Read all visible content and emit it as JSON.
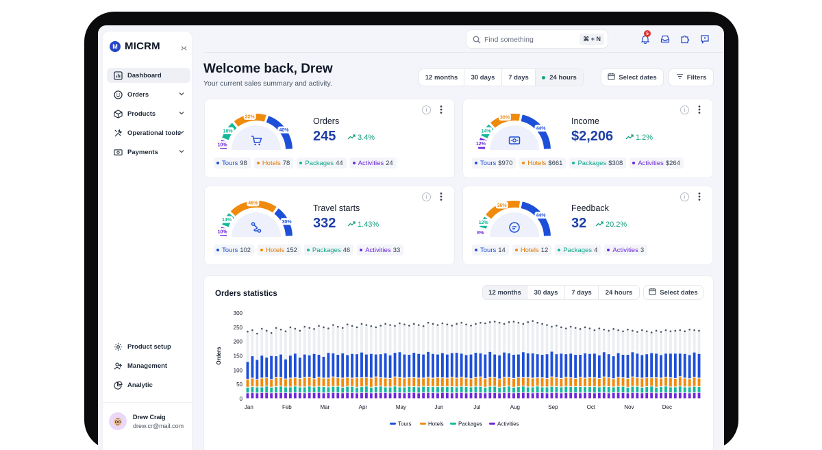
{
  "brand": {
    "name": "MICRM",
    "logo_letter": "M"
  },
  "sidebar": {
    "items": [
      {
        "label": "Dashboard",
        "icon": "chart-bar-icon"
      },
      {
        "label": "Orders",
        "icon": "smile-icon"
      },
      {
        "label": "Products",
        "icon": "box-icon"
      },
      {
        "label": "Operational tools",
        "icon": "tools-icon"
      },
      {
        "label": "Payments",
        "icon": "money-icon"
      }
    ],
    "bottom_items": [
      {
        "label": "Product setup",
        "icon": "gear-icon"
      },
      {
        "label": "Management",
        "icon": "users-icon"
      },
      {
        "label": "Analytic",
        "icon": "pie-chart-icon"
      }
    ],
    "user": {
      "name": "Drew Craig",
      "email": "drew.cr@mail.com"
    }
  },
  "topbar": {
    "search_placeholder": "Find something",
    "shortcut": "⌘ + N",
    "notification_count": "5"
  },
  "header": {
    "title": "Welcome back, Drew",
    "subtitle": "Your current sales summary and activity.",
    "ranges": [
      "12 months",
      "30 days",
      "7 days",
      "24 hours"
    ],
    "active_range": "24 hours",
    "select_dates": "Select dates",
    "filters": "Filters"
  },
  "colors": {
    "tours": "#1d4fd8",
    "hotels": "#f08a0c",
    "packages": "#14b89a",
    "activities": "#6d28d9",
    "accent": "#1d3fa8",
    "positive": "#16a07f"
  },
  "cards": [
    {
      "title": "Orders",
      "value": "245",
      "delta": "3.4%",
      "icon": "cart-icon",
      "segments": [
        {
          "pct": "10%",
          "share": 10
        },
        {
          "pct": "18%",
          "share": 18
        },
        {
          "pct": "32%",
          "share": 32
        },
        {
          "pct": "40%",
          "share": 40
        }
      ],
      "legend": [
        {
          "name": "Tours",
          "value": "98"
        },
        {
          "name": "Hotels",
          "value": "78"
        },
        {
          "name": "Packages",
          "value": "44"
        },
        {
          "name": "Activities",
          "value": "24"
        }
      ]
    },
    {
      "title": "Income",
      "value": "$2,206",
      "delta": "1.2%",
      "icon": "money-icon",
      "segments": [
        {
          "pct": "12%",
          "share": 12
        },
        {
          "pct": "14%",
          "share": 14
        },
        {
          "pct": "30%",
          "share": 30
        },
        {
          "pct": "44%",
          "share": 44
        }
      ],
      "legend": [
        {
          "name": "Tours",
          "value": "$970"
        },
        {
          "name": "Hotels",
          "value": "$661"
        },
        {
          "name": "Packages",
          "value": "$308"
        },
        {
          "name": "Activities",
          "value": "$264"
        }
      ]
    },
    {
      "title": "Travel starts",
      "value": "332",
      "delta": "1.43%",
      "icon": "route-icon",
      "segments": [
        {
          "pct": "10%",
          "share": 10
        },
        {
          "pct": "14%",
          "share": 14
        },
        {
          "pct": "46%",
          "share": 46
        },
        {
          "pct": "30%",
          "share": 30
        }
      ],
      "legend": [
        {
          "name": "Tours",
          "value": "102"
        },
        {
          "name": "Hotels",
          "value": "152"
        },
        {
          "name": "Packages",
          "value": "46"
        },
        {
          "name": "Activities",
          "value": "33"
        }
      ]
    },
    {
      "title": "Feedback",
      "value": "32",
      "delta": "20.2%",
      "icon": "chat-icon",
      "segments": [
        {
          "pct": "8%",
          "share": 8
        },
        {
          "pct": "12%",
          "share": 12
        },
        {
          "pct": "36%",
          "share": 36
        },
        {
          "pct": "44%",
          "share": 44
        }
      ],
      "legend": [
        {
          "name": "Tours",
          "value": "14"
        },
        {
          "name": "Hotels",
          "value": "12"
        },
        {
          "name": "Packages",
          "value": "4"
        },
        {
          "name": "Activities",
          "value": "3"
        }
      ]
    }
  ],
  "stats": {
    "title": "Orders statistics",
    "ranges": [
      "12 months",
      "30 days",
      "7 days",
      "24 hours"
    ],
    "active_range": "12 months",
    "select_dates": "Select dates"
  },
  "chart_data": {
    "type": "bar",
    "stacked": true,
    "ylabel": "Orders",
    "ylim": [
      0,
      300
    ],
    "yticks": [
      0,
      50,
      100,
      150,
      200,
      250,
      300
    ],
    "month_labels": [
      "Jan",
      "Feb",
      "Mar",
      "Apr",
      "May",
      "Jun",
      "Jul",
      "Aug",
      "Sep",
      "Oct",
      "Nov",
      "Dec"
    ],
    "bars_per_month": 8,
    "legend": [
      "Tours",
      "Hotels",
      "Packages",
      "Activities"
    ],
    "legend_position": "bottom",
    "series": [
      {
        "name": "Activities",
        "values": [
          20,
          22,
          20,
          21,
          22,
          20,
          21,
          22,
          21,
          20,
          22,
          21,
          20,
          22,
          21,
          22,
          20,
          21,
          22,
          21,
          20,
          22,
          21,
          20,
          21,
          22,
          20,
          21,
          22,
          21,
          20,
          22,
          21,
          20,
          21,
          22,
          20,
          21,
          22,
          21,
          20,
          22,
          21,
          20,
          21,
          22,
          20,
          21,
          22,
          21,
          20,
          22,
          21,
          20,
          21,
          22,
          20,
          21,
          22,
          21,
          20,
          22,
          21,
          20,
          21,
          22,
          20,
          21,
          22,
          21,
          20,
          22,
          21,
          20,
          21,
          22,
          20,
          21,
          22,
          21,
          20,
          22,
          21,
          20,
          21,
          22,
          20,
          21,
          22,
          21,
          20,
          22,
          21,
          20,
          21,
          22
        ]
      },
      {
        "name": "Packages",
        "values": [
          20,
          20,
          21,
          20,
          22,
          20,
          21,
          22,
          20,
          21,
          22,
          20,
          21,
          22,
          20,
          21,
          22,
          20,
          21,
          22,
          20,
          21,
          22,
          20,
          21,
          22,
          20,
          21,
          22,
          20,
          21,
          22,
          20,
          21,
          22,
          20,
          21,
          22,
          20,
          21,
          22,
          20,
          21,
          22,
          20,
          21,
          22,
          20,
          21,
          22,
          20,
          21,
          22,
          20,
          21,
          22,
          20,
          21,
          22,
          20,
          21,
          22,
          20,
          21,
          22,
          20,
          21,
          22,
          20,
          21,
          22,
          20,
          21,
          22,
          20,
          21,
          22,
          20,
          21,
          22,
          20,
          21,
          22,
          20,
          21,
          22,
          20,
          21,
          22,
          20,
          21,
          22,
          20,
          21,
          22,
          20
        ]
      },
      {
        "name": "Hotels",
        "values": [
          28,
          30,
          26,
          31,
          29,
          27,
          32,
          30,
          28,
          31,
          29,
          30,
          33,
          31,
          29,
          32,
          30,
          31,
          33,
          30,
          32,
          31,
          29,
          33,
          31,
          30,
          32,
          34,
          29,
          31,
          30,
          32,
          33,
          31,
          30,
          32,
          31,
          29,
          33,
          30,
          32,
          31,
          30,
          33,
          31,
          32,
          30,
          29,
          31,
          33,
          30,
          32,
          31,
          29,
          33,
          30,
          31,
          32,
          30,
          33,
          31,
          29,
          32,
          30,
          33,
          31,
          30,
          32,
          31,
          29,
          33,
          30,
          32,
          31,
          30,
          33,
          31,
          29,
          32,
          30,
          31,
          33,
          30,
          32,
          31,
          29,
          33,
          30,
          31,
          32,
          30,
          33,
          31,
          29,
          32,
          30
        ]
      },
      {
        "name": "Tours",
        "values": [
          62,
          78,
          70,
          80,
          72,
          84,
          76,
          82,
          70,
          80,
          86,
          74,
          82,
          78,
          88,
          80,
          76,
          90,
          84,
          82,
          88,
          80,
          86,
          84,
          90,
          82,
          86,
          80,
          84,
          88,
          82,
          86,
          90,
          84,
          82,
          88,
          86,
          84,
          90,
          86,
          82,
          88,
          84,
          86,
          90,
          84,
          82,
          86,
          88,
          84,
          86,
          90,
          82,
          84,
          88,
          86,
          84,
          82,
          90,
          86,
          88,
          84,
          82,
          86,
          90,
          84,
          88,
          82,
          86,
          84,
          80,
          88,
          84,
          86,
          82,
          88,
          84,
          80,
          86,
          82,
          84,
          88,
          86,
          82,
          84,
          88,
          86,
          82,
          84,
          86,
          88,
          82,
          86,
          84,
          88,
          86
        ]
      },
      {
        "name": "Total",
        "values": [
          235,
          240,
          228,
          245,
          238,
          230,
          248,
          242,
          236,
          250,
          245,
          238,
          252,
          248,
          244,
          255,
          250,
          246,
          258,
          252,
          248,
          260,
          255,
          250,
          262,
          258,
          254,
          250,
          256,
          262,
          258,
          255,
          264,
          260,
          256,
          262,
          258,
          254,
          266,
          262,
          258,
          264,
          260,
          256,
          262,
          266,
          260,
          256,
          262,
          266,
          264,
          268,
          270,
          266,
          262,
          268,
          270,
          266,
          262,
          268,
          272,
          266,
          262,
          258,
          252,
          256,
          250,
          246,
          252,
          248,
          244,
          250,
          246,
          240,
          246,
          242,
          238,
          244,
          240,
          236,
          242,
          238,
          234,
          240,
          236,
          232,
          238,
          234,
          240,
          236,
          238,
          240,
          236,
          242,
          240,
          238
        ]
      }
    ]
  }
}
